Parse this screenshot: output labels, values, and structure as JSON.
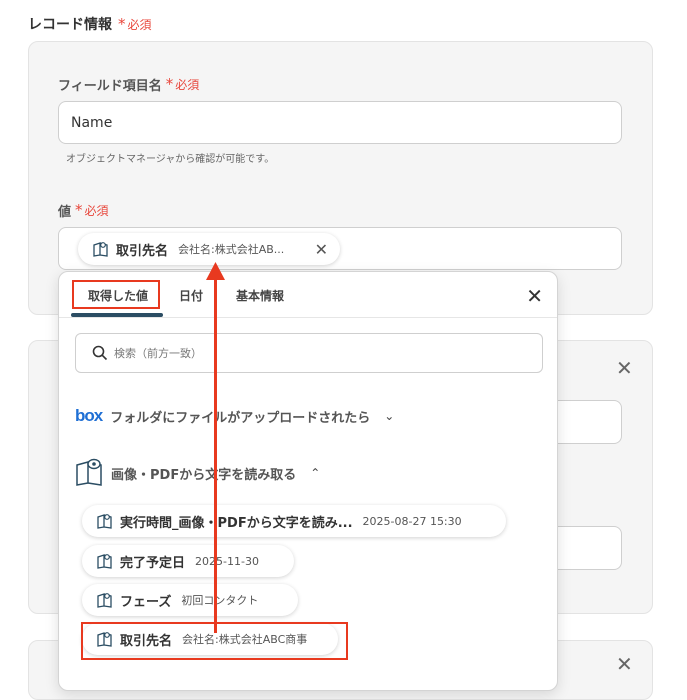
{
  "section": {
    "title": "レコード情報",
    "required": "必須"
  },
  "field_name": {
    "label": "フィールド項目名",
    "required": "必須",
    "value": "Name",
    "helper": "オブジェクトマネージャから確認が可能です。"
  },
  "value_field": {
    "label": "値",
    "required": "必須",
    "chip": {
      "name": "取引先名",
      "value": "会社名:株式会社AB..."
    }
  },
  "panel": {
    "tabs": [
      "取得した値",
      "日付",
      "基本情報"
    ],
    "active_tab": "取得した値",
    "search_placeholder": "検索（前方一致）",
    "groups": [
      {
        "logo": "box",
        "label": "フォルダにファイルがアップロードされたら",
        "expanded": false
      },
      {
        "label": "画像・PDFから文字を読み取る",
        "expanded": true
      }
    ],
    "items": [
      {
        "name": "実行時間_画像・PDFから文字を読み...",
        "value": "2025-08-27 15:30"
      },
      {
        "name": "完了予定日",
        "value": "2025-11-30"
      },
      {
        "name": "フェーズ",
        "value": "初回コンタクト"
      },
      {
        "name": "取引先名",
        "value": "会社名:株式会社ABC商事"
      }
    ]
  },
  "colors": {
    "accent": "#2b4d63",
    "required": "#e8473c",
    "highlight": "#e8391f",
    "box": "#1f6fd4"
  }
}
